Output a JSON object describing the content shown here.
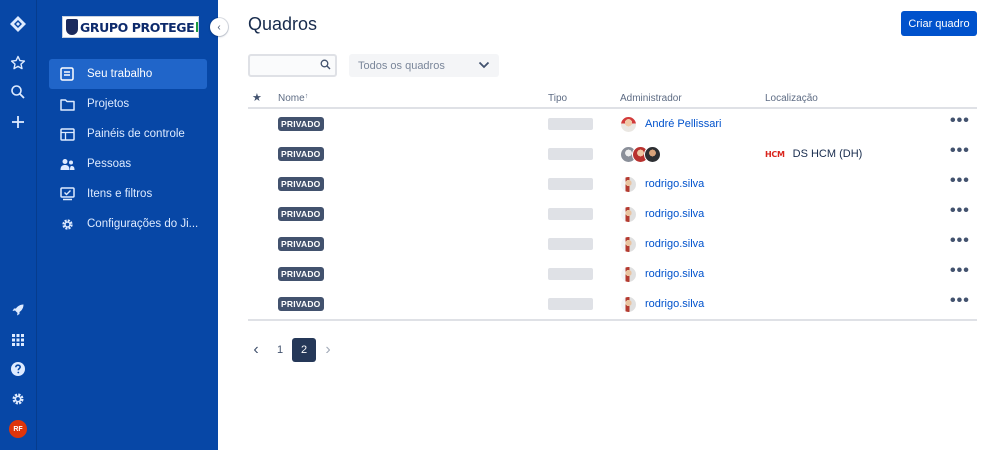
{
  "app": {
    "logo_text": "GRUPO PROTEGE"
  },
  "rail": {
    "avatar_initials": "RF"
  },
  "sidebar": {
    "collapse_glyph": "‹",
    "items": [
      {
        "label": "Seu trabalho",
        "icon": "work-icon",
        "active": true
      },
      {
        "label": "Projetos",
        "icon": "folder-icon",
        "active": false
      },
      {
        "label": "Painéis de controle",
        "icon": "dashboard-icon",
        "active": false
      },
      {
        "label": "Pessoas",
        "icon": "people-icon",
        "active": false
      },
      {
        "label": "Itens e filtros",
        "icon": "filter-icon",
        "active": false
      },
      {
        "label": "Configurações do Ji...",
        "icon": "gear-icon",
        "active": false
      }
    ]
  },
  "main": {
    "title": "Quadros",
    "create_button": "Criar quadro",
    "search": {
      "value": "",
      "placeholder": ""
    },
    "filter_select": {
      "value": "Todos os quadros"
    },
    "table": {
      "headers": {
        "star": "★",
        "name": "Nome",
        "name_sort": "↑",
        "type": "Tipo",
        "admin": "Administrador",
        "location": "Localização"
      },
      "rows": [
        {
          "badge": "PRIVADO",
          "admin": "André Pellissari",
          "admin_avatar": "andre",
          "location": "",
          "location_logo": ""
        },
        {
          "badge": "PRIVADO",
          "admin": "",
          "admin_avatar": "group",
          "location": "DS HCM (DH)",
          "location_logo": "HCM"
        },
        {
          "badge": "PRIVADO",
          "admin": "rodrigo.silva",
          "admin_avatar": "rodrigo",
          "location": "",
          "location_logo": ""
        },
        {
          "badge": "PRIVADO",
          "admin": "rodrigo.silva",
          "admin_avatar": "rodrigo",
          "location": "",
          "location_logo": ""
        },
        {
          "badge": "PRIVADO",
          "admin": "rodrigo.silva",
          "admin_avatar": "rodrigo",
          "location": "",
          "location_logo": ""
        },
        {
          "badge": "PRIVADO",
          "admin": "rodrigo.silva",
          "admin_avatar": "rodrigo",
          "location": "",
          "location_logo": ""
        },
        {
          "badge": "PRIVADO",
          "admin": "rodrigo.silva",
          "admin_avatar": "rodrigo",
          "location": "",
          "location_logo": ""
        }
      ],
      "more_glyph": "•••"
    },
    "pagination": {
      "prev": "‹",
      "pages": [
        "1",
        "2"
      ],
      "current": "2",
      "next": "›"
    }
  },
  "colors": {
    "sidebar_bg": "#0747a6",
    "active_item": "#2065c9",
    "primary": "#0052cc",
    "lozenge": "#42526e"
  }
}
